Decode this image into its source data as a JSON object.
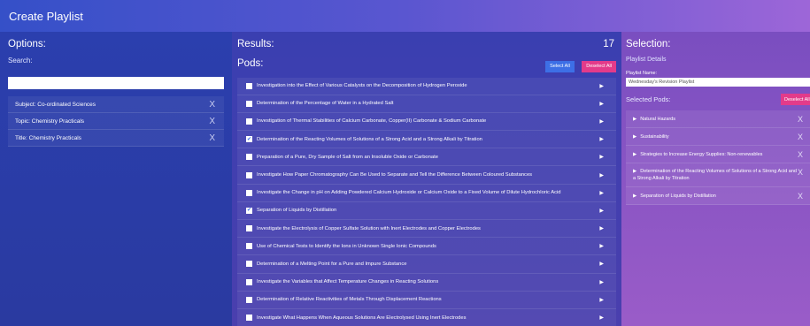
{
  "window": {
    "title": "Create Playlist"
  },
  "options": {
    "heading": "Options:",
    "search_label": "Search:",
    "search_value": "",
    "filters": [
      {
        "label": "Subject: Co-ordinated Sciences",
        "remove_icon": "X"
      },
      {
        "label": "Topic: Chemistry Practicals",
        "remove_icon": "X"
      },
      {
        "label": "Title: Chemistry Practicals",
        "remove_icon": "X"
      }
    ]
  },
  "results": {
    "heading": "Results:",
    "count": "17",
    "pods_heading": "Pods:",
    "select_all_label": "Select All",
    "deselect_all_label": "Deselect All",
    "pods": [
      {
        "title": "Investigation into the Effect of Various Catalysts on the Decomposition of Hydrogen Peroxide",
        "checked": false
      },
      {
        "title": "Determination of the Percentage of Water in a Hydrated Salt",
        "checked": false
      },
      {
        "title": "Investigation of Thermal Stabilities of Calcium Carbonate, Copper(II) Carbonate & Sodium Carbonate",
        "checked": false
      },
      {
        "title": "Determination of the Reacting Volumes of Solutions of a Strong Acid and a Strong Alkali by Titration",
        "checked": true
      },
      {
        "title": "Preparation of a Pure, Dry Sample of Salt from an Insoluble Oxide or Carbonate",
        "checked": false
      },
      {
        "title": "Investigate How Paper Chromatography Can Be Used to Separate and Tell the Difference Between Coloured Substances",
        "checked": false
      },
      {
        "title": "Investigate the Change in pH on Adding Powdered Calcium Hydroxide or Calcium Oxide to a Fixed Volume of Dilute Hydrochloric Acid",
        "checked": false
      },
      {
        "title": "Separation of Liquids by Distillation",
        "checked": true
      },
      {
        "title": "Investigate the Electrolysis of Copper Sulfate Solution with Inert Electrodes and Copper Electrodes",
        "checked": false
      },
      {
        "title": "Use of Chemical Tests to Identify the Ions in Unknown Single Ionic Compounds",
        "checked": false
      },
      {
        "title": "Determination of a Melting Point for a Pure and Impure Substance",
        "checked": false
      },
      {
        "title": "Investigate the Variables that Affect Temperature Changes in Reacting Solutions",
        "checked": false
      },
      {
        "title": "Determination of Relative Reactivities of Metals Through Displacement Reactions",
        "checked": false
      },
      {
        "title": "Investigate What Happens When Aqueous Solutions Are Electrolysed Using Inert Electrodes",
        "checked": false
      }
    ]
  },
  "selection": {
    "heading": "Selection:",
    "details_label": "Playlist Details",
    "name_label": "Playlist Name:",
    "name_value": "Wednesday's Revision Playlist",
    "selected_pods_label": "Selected Pods:",
    "deselect_all_label": "Deselect All",
    "selected": [
      {
        "title": "Natural Hazards"
      },
      {
        "title": "Sustainability"
      },
      {
        "title": "Strategies to Increase Energy Supplies: Non-renewables"
      },
      {
        "title": "Determination of the Reacting Volumes of Solutions of a Strong Acid and a Strong Alkali by Titration"
      },
      {
        "title": "Separation of Liquids by Distillation"
      }
    ]
  },
  "colors": {
    "accent_blue": "#3d6fe6",
    "accent_pink": "#e33b8a"
  }
}
